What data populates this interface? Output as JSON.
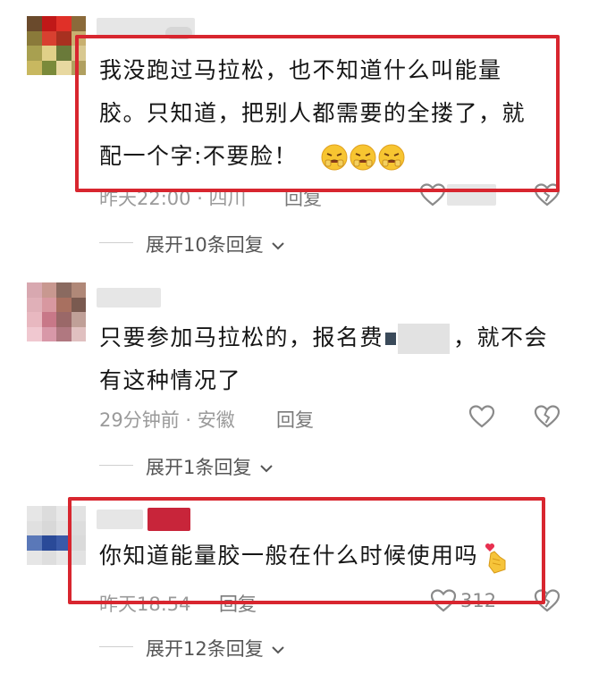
{
  "comments": [
    {
      "text_lines": [
        "我没跑过马拉松，也不知道什么叫能量",
        "胶。只知道，把别人都需要的全搂了，就",
        "配一个字:不要脸！"
      ],
      "emoji_count": 3,
      "meta": "昨天22:00 · 四川",
      "reply": "回复",
      "expand": "展开10条回复"
    },
    {
      "text_lines": [
        "只要参加马拉松的，报名费",
        "，就不会",
        "有这种情况了"
      ],
      "meta": "29分钟前 · 安徽",
      "reply": "回复",
      "expand": "展开1条回复"
    },
    {
      "text_lines": [
        "你知道能量胶一般在什么时候使用吗"
      ],
      "meta": "昨天18:54",
      "reply": "回复",
      "like_count": "312",
      "expand": "展开12条回复"
    }
  ],
  "colors": {
    "highlight": "#d8262f",
    "meta": "#9a9a9a",
    "text": "#161616"
  },
  "icons": [
    "heart-icon",
    "dislike-heart-icon",
    "chevron-down-icon",
    "weary-face-emoji",
    "finger-heart-emoji"
  ]
}
